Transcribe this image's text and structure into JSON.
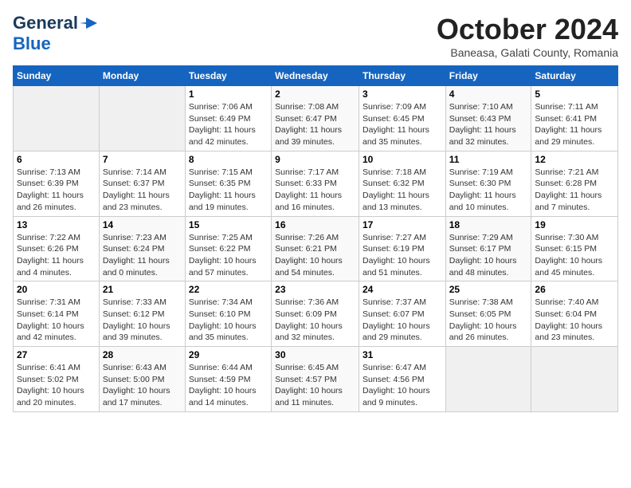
{
  "header": {
    "logo_line1": "General",
    "logo_line2": "Blue",
    "month": "October 2024",
    "location": "Baneasa, Galati County, Romania"
  },
  "days_of_week": [
    "Sunday",
    "Monday",
    "Tuesday",
    "Wednesday",
    "Thursday",
    "Friday",
    "Saturday"
  ],
  "weeks": [
    [
      {
        "day": "",
        "sunrise": "",
        "sunset": "",
        "daylight": ""
      },
      {
        "day": "",
        "sunrise": "",
        "sunset": "",
        "daylight": ""
      },
      {
        "day": "1",
        "sunrise": "Sunrise: 7:06 AM",
        "sunset": "Sunset: 6:49 PM",
        "daylight": "Daylight: 11 hours and 42 minutes."
      },
      {
        "day": "2",
        "sunrise": "Sunrise: 7:08 AM",
        "sunset": "Sunset: 6:47 PM",
        "daylight": "Daylight: 11 hours and 39 minutes."
      },
      {
        "day": "3",
        "sunrise": "Sunrise: 7:09 AM",
        "sunset": "Sunset: 6:45 PM",
        "daylight": "Daylight: 11 hours and 35 minutes."
      },
      {
        "day": "4",
        "sunrise": "Sunrise: 7:10 AM",
        "sunset": "Sunset: 6:43 PM",
        "daylight": "Daylight: 11 hours and 32 minutes."
      },
      {
        "day": "5",
        "sunrise": "Sunrise: 7:11 AM",
        "sunset": "Sunset: 6:41 PM",
        "daylight": "Daylight: 11 hours and 29 minutes."
      }
    ],
    [
      {
        "day": "6",
        "sunrise": "Sunrise: 7:13 AM",
        "sunset": "Sunset: 6:39 PM",
        "daylight": "Daylight: 11 hours and 26 minutes."
      },
      {
        "day": "7",
        "sunrise": "Sunrise: 7:14 AM",
        "sunset": "Sunset: 6:37 PM",
        "daylight": "Daylight: 11 hours and 23 minutes."
      },
      {
        "day": "8",
        "sunrise": "Sunrise: 7:15 AM",
        "sunset": "Sunset: 6:35 PM",
        "daylight": "Daylight: 11 hours and 19 minutes."
      },
      {
        "day": "9",
        "sunrise": "Sunrise: 7:17 AM",
        "sunset": "Sunset: 6:33 PM",
        "daylight": "Daylight: 11 hours and 16 minutes."
      },
      {
        "day": "10",
        "sunrise": "Sunrise: 7:18 AM",
        "sunset": "Sunset: 6:32 PM",
        "daylight": "Daylight: 11 hours and 13 minutes."
      },
      {
        "day": "11",
        "sunrise": "Sunrise: 7:19 AM",
        "sunset": "Sunset: 6:30 PM",
        "daylight": "Daylight: 11 hours and 10 minutes."
      },
      {
        "day": "12",
        "sunrise": "Sunrise: 7:21 AM",
        "sunset": "Sunset: 6:28 PM",
        "daylight": "Daylight: 11 hours and 7 minutes."
      }
    ],
    [
      {
        "day": "13",
        "sunrise": "Sunrise: 7:22 AM",
        "sunset": "Sunset: 6:26 PM",
        "daylight": "Daylight: 11 hours and 4 minutes."
      },
      {
        "day": "14",
        "sunrise": "Sunrise: 7:23 AM",
        "sunset": "Sunset: 6:24 PM",
        "daylight": "Daylight: 11 hours and 0 minutes."
      },
      {
        "day": "15",
        "sunrise": "Sunrise: 7:25 AM",
        "sunset": "Sunset: 6:22 PM",
        "daylight": "Daylight: 10 hours and 57 minutes."
      },
      {
        "day": "16",
        "sunrise": "Sunrise: 7:26 AM",
        "sunset": "Sunset: 6:21 PM",
        "daylight": "Daylight: 10 hours and 54 minutes."
      },
      {
        "day": "17",
        "sunrise": "Sunrise: 7:27 AM",
        "sunset": "Sunset: 6:19 PM",
        "daylight": "Daylight: 10 hours and 51 minutes."
      },
      {
        "day": "18",
        "sunrise": "Sunrise: 7:29 AM",
        "sunset": "Sunset: 6:17 PM",
        "daylight": "Daylight: 10 hours and 48 minutes."
      },
      {
        "day": "19",
        "sunrise": "Sunrise: 7:30 AM",
        "sunset": "Sunset: 6:15 PM",
        "daylight": "Daylight: 10 hours and 45 minutes."
      }
    ],
    [
      {
        "day": "20",
        "sunrise": "Sunrise: 7:31 AM",
        "sunset": "Sunset: 6:14 PM",
        "daylight": "Daylight: 10 hours and 42 minutes."
      },
      {
        "day": "21",
        "sunrise": "Sunrise: 7:33 AM",
        "sunset": "Sunset: 6:12 PM",
        "daylight": "Daylight: 10 hours and 39 minutes."
      },
      {
        "day": "22",
        "sunrise": "Sunrise: 7:34 AM",
        "sunset": "Sunset: 6:10 PM",
        "daylight": "Daylight: 10 hours and 35 minutes."
      },
      {
        "day": "23",
        "sunrise": "Sunrise: 7:36 AM",
        "sunset": "Sunset: 6:09 PM",
        "daylight": "Daylight: 10 hours and 32 minutes."
      },
      {
        "day": "24",
        "sunrise": "Sunrise: 7:37 AM",
        "sunset": "Sunset: 6:07 PM",
        "daylight": "Daylight: 10 hours and 29 minutes."
      },
      {
        "day": "25",
        "sunrise": "Sunrise: 7:38 AM",
        "sunset": "Sunset: 6:05 PM",
        "daylight": "Daylight: 10 hours and 26 minutes."
      },
      {
        "day": "26",
        "sunrise": "Sunrise: 7:40 AM",
        "sunset": "Sunset: 6:04 PM",
        "daylight": "Daylight: 10 hours and 23 minutes."
      }
    ],
    [
      {
        "day": "27",
        "sunrise": "Sunrise: 6:41 AM",
        "sunset": "Sunset: 5:02 PM",
        "daylight": "Daylight: 10 hours and 20 minutes."
      },
      {
        "day": "28",
        "sunrise": "Sunrise: 6:43 AM",
        "sunset": "Sunset: 5:00 PM",
        "daylight": "Daylight: 10 hours and 17 minutes."
      },
      {
        "day": "29",
        "sunrise": "Sunrise: 6:44 AM",
        "sunset": "Sunset: 4:59 PM",
        "daylight": "Daylight: 10 hours and 14 minutes."
      },
      {
        "day": "30",
        "sunrise": "Sunrise: 6:45 AM",
        "sunset": "Sunset: 4:57 PM",
        "daylight": "Daylight: 10 hours and 11 minutes."
      },
      {
        "day": "31",
        "sunrise": "Sunrise: 6:47 AM",
        "sunset": "Sunset: 4:56 PM",
        "daylight": "Daylight: 10 hours and 9 minutes."
      },
      {
        "day": "",
        "sunrise": "",
        "sunset": "",
        "daylight": ""
      },
      {
        "day": "",
        "sunrise": "",
        "sunset": "",
        "daylight": ""
      }
    ]
  ]
}
